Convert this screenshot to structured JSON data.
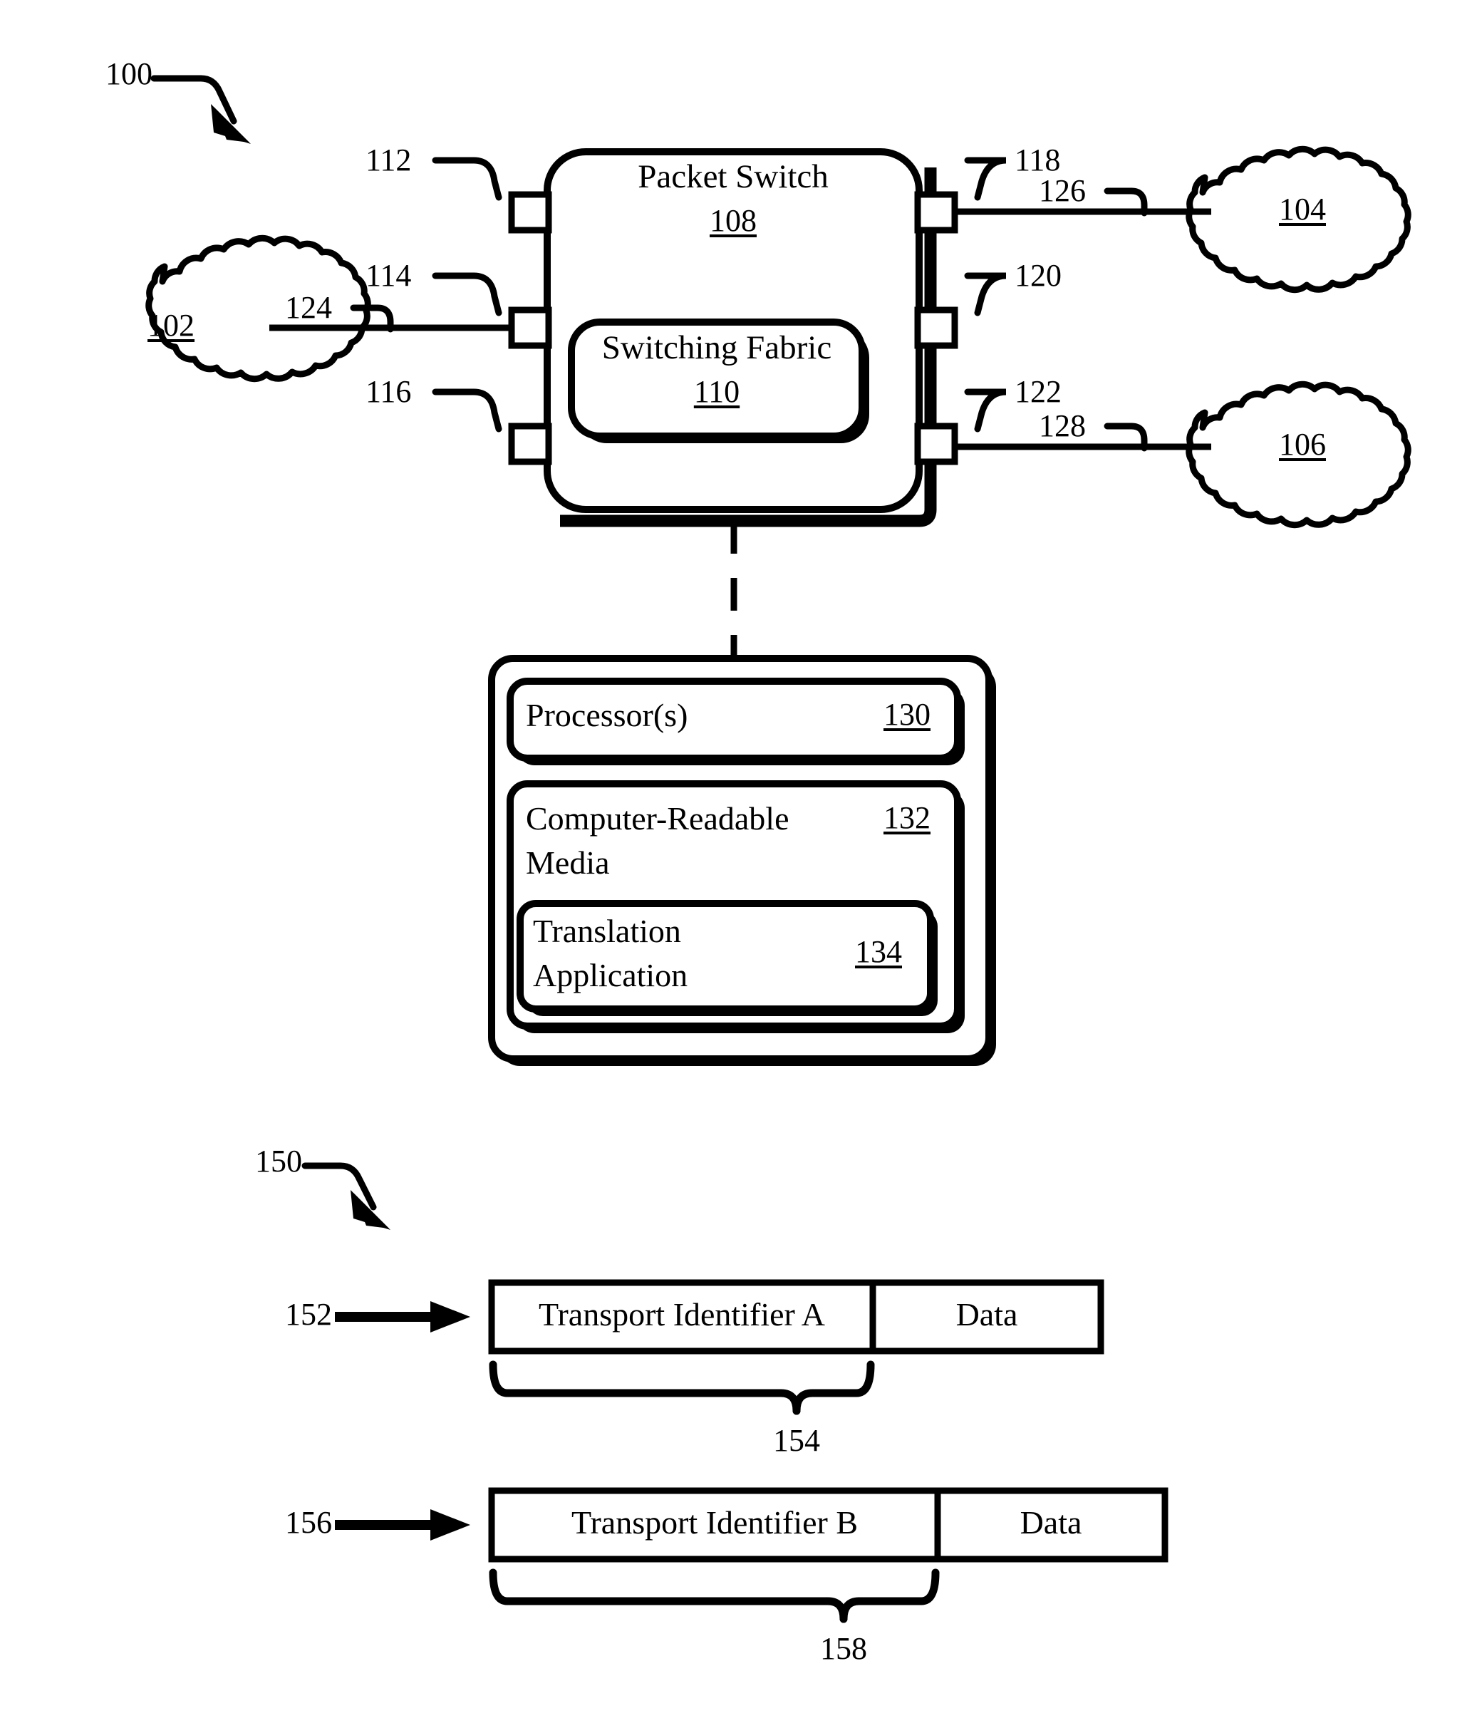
{
  "figure": {
    "top_figure_ref": "100",
    "bottom_figure_ref": "150"
  },
  "packet_switch": {
    "title": "Packet Switch",
    "ref": "108",
    "switching_fabric": {
      "title": "Switching Fabric",
      "ref": "110"
    },
    "left_ports": [
      {
        "ref": "112"
      },
      {
        "ref": "114"
      },
      {
        "ref": "116"
      }
    ],
    "right_ports": [
      {
        "ref": "118"
      },
      {
        "ref": "120"
      },
      {
        "ref": "122"
      }
    ]
  },
  "networks": [
    {
      "ref": "102",
      "side": "left",
      "link_ref": "124"
    },
    {
      "ref": "104",
      "side": "right-top",
      "link_ref": "126"
    },
    {
      "ref": "106",
      "side": "right-bottom",
      "link_ref": "128"
    }
  ],
  "links": [
    {
      "ref": "124"
    },
    {
      "ref": "126"
    },
    {
      "ref": "128"
    }
  ],
  "computing_device": {
    "processor": {
      "label": "Processor(s)",
      "ref": "130"
    },
    "media": {
      "label_line1": "Computer-Readable",
      "label_line2": "Media",
      "ref": "132"
    },
    "application": {
      "label_line1": "Translation",
      "label_line2": "Application",
      "ref": "134"
    }
  },
  "packets": [
    {
      "ref": "152",
      "header_label": "Transport Identifier A",
      "payload_label": "Data",
      "brace_ref": "154"
    },
    {
      "ref": "156",
      "header_label": "Transport Identifier B",
      "payload_label": "Data",
      "brace_ref": "158"
    }
  ],
  "colors": {
    "stroke": "#000000",
    "background": "#ffffff"
  }
}
